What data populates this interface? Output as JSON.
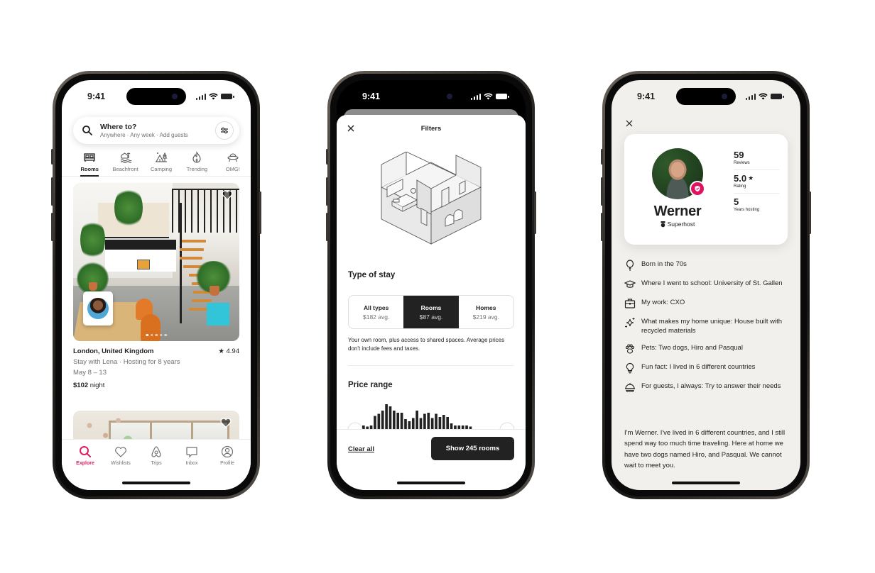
{
  "status_bar": {
    "time": "9:41"
  },
  "explore_screen": {
    "search": {
      "title": "Where to?",
      "subtitle": "Anywhere · Any week · Add guests"
    },
    "categories": [
      {
        "label": "Rooms",
        "icon": "rooms-icon",
        "active": true
      },
      {
        "label": "Beachfront",
        "icon": "beachfront-icon",
        "active": false
      },
      {
        "label": "Camping",
        "icon": "camping-icon",
        "active": false
      },
      {
        "label": "Trending",
        "icon": "flame-icon",
        "active": false
      },
      {
        "label": "OMG!",
        "icon": "ufo-icon",
        "active": false
      }
    ],
    "listing": {
      "location": "London, United Kingdom",
      "rating": "4.94",
      "host_line": "Stay with Lena · Hosting for 8 years",
      "dates": "May 8 – 13",
      "price": "$102",
      "price_unit": "night",
      "photo_count": 5,
      "photo_index": 1
    },
    "tabbar": [
      {
        "label": "Explore",
        "icon": "search-icon",
        "active": true
      },
      {
        "label": "Wishlists",
        "icon": "heart-icon",
        "active": false
      },
      {
        "label": "Trips",
        "icon": "airbnb-logo-icon",
        "active": false
      },
      {
        "label": "Inbox",
        "icon": "message-icon",
        "active": false
      },
      {
        "label": "Profile",
        "icon": "profile-icon",
        "active": false
      }
    ],
    "accent_color": "#e31c5f"
  },
  "filters_screen": {
    "title": "Filters",
    "type_of_stay": {
      "heading": "Type of stay",
      "options": [
        {
          "label": "All types",
          "value": "$182 avg.",
          "active": false
        },
        {
          "label": "Rooms",
          "value": "$87 avg.",
          "active": true
        },
        {
          "label": "Homes",
          "value": "$219 avg.",
          "active": false
        }
      ],
      "description": "Your own room, plus access to shared spaces. Average prices don't include fees and taxes."
    },
    "price_range": {
      "heading": "Price range",
      "histogram": [
        4,
        3,
        4,
        13,
        15,
        18,
        24,
        22,
        18,
        16,
        16,
        10,
        8,
        11,
        18,
        11,
        15,
        16,
        11,
        15,
        12,
        14,
        12,
        6,
        4,
        4,
        4,
        4,
        3
      ],
      "range_min_fraction": 0,
      "range_max_fraction": 1
    },
    "footer": {
      "clear_label": "Clear all",
      "show_label": "Show 245 rooms"
    }
  },
  "profile_screen": {
    "name": "Werner",
    "badge": "Superhost",
    "stats": [
      {
        "value": "59",
        "label": "Reviews",
        "star": false
      },
      {
        "value": "5.0",
        "label": "Rating",
        "star": true
      },
      {
        "value": "5",
        "label": "Years hosting",
        "star": false
      }
    ],
    "facts": [
      {
        "icon": "balloon-icon",
        "text": "Born in the 70s"
      },
      {
        "icon": "graduation-cap-icon",
        "text": "Where I went to school: University of St. Gallen"
      },
      {
        "icon": "briefcase-icon",
        "text": "My work: CXO"
      },
      {
        "icon": "sparkles-icon",
        "text": "What makes my home unique: House built with recycled materials"
      },
      {
        "icon": "paw-icon",
        "text": "Pets: Two dogs, Hiro and Pasqual"
      },
      {
        "icon": "lightbulb-icon",
        "text": "Fun fact: I lived in 6 different countries"
      },
      {
        "icon": "cloche-icon",
        "text": "For guests, I always: Try to answer their needs"
      }
    ],
    "bio": "I'm Werner. I've lived in 6 different countries, and I still spend way too much time traveling. Here at home we have two dogs named Hiro, and Pasqual. We cannot wait to meet you.",
    "badge_color": "#e0125f"
  }
}
